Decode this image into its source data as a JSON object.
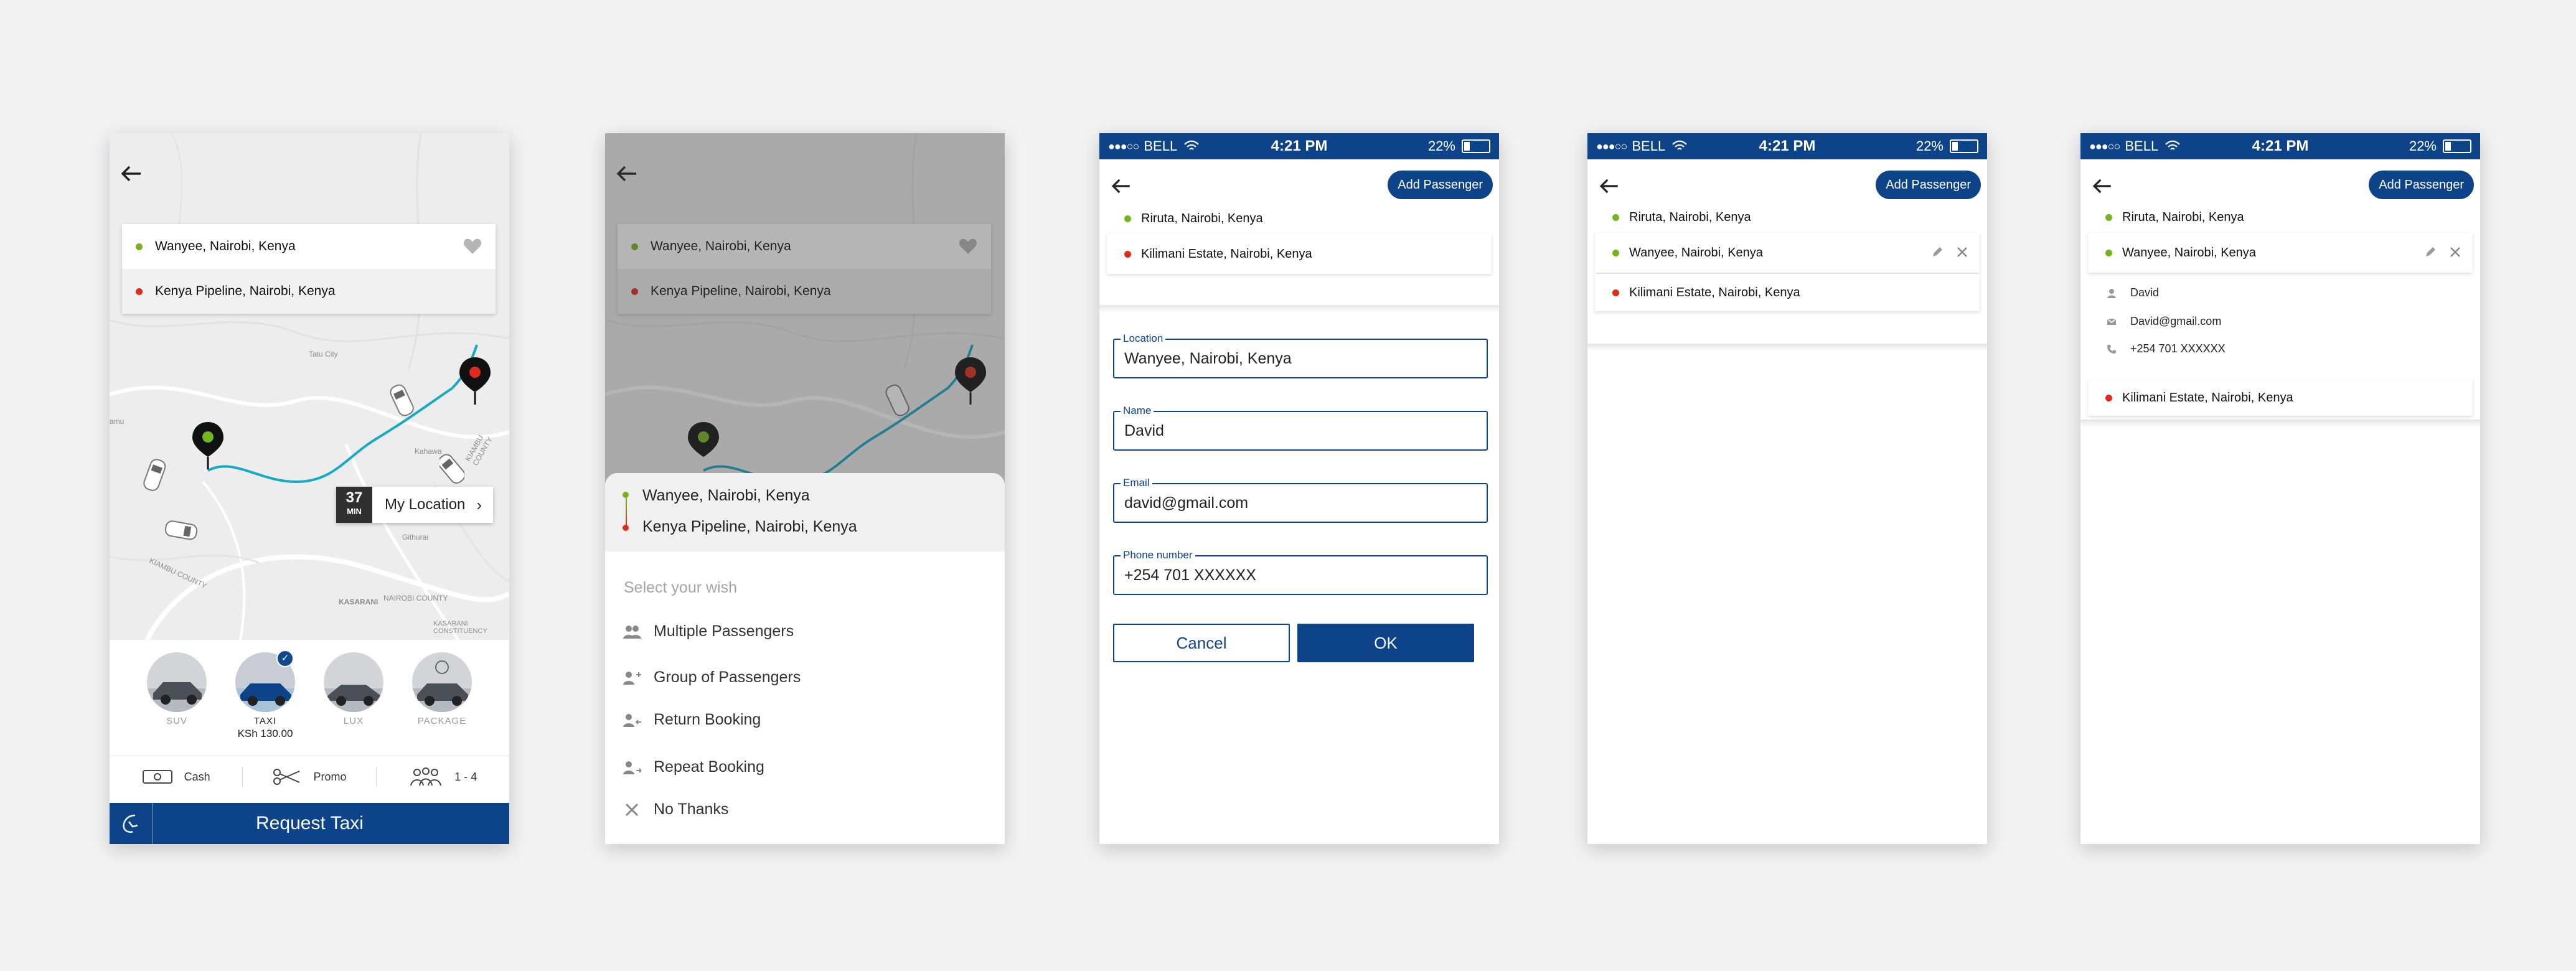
{
  "screen1": {
    "pickup": "Wanyee, Nairobi, Kenya",
    "dropoff": "Kenya Pipeline, Nairobi, Kenya",
    "map_labels": [
      "Tatu City",
      "Kahawa",
      "KIAMBU COUNTY",
      "KIAMBU COUNTY",
      "NAIROBI COUNTY",
      "Githurai",
      "KASARANI",
      "KASARANI CONSTITUENCY",
      "amu"
    ],
    "eta": {
      "value": "37",
      "unit": "MIN",
      "label": "My Location"
    },
    "cars": [
      {
        "name": "SUV",
        "price": "",
        "selected": false
      },
      {
        "name": "TAXI",
        "price": "KSh 130.00",
        "selected": true
      },
      {
        "name": "LUX",
        "price": "",
        "selected": false
      },
      {
        "name": "PACKAGE",
        "price": "",
        "selected": false
      }
    ],
    "options": {
      "cash": "Cash",
      "promo": "Promo",
      "seats": "1 - 4"
    },
    "request_label": "Request Taxi"
  },
  "screen2": {
    "pickup": "Wanyee, Nairobi, Kenya",
    "dropoff": "Kenya Pipeline, Nairobi, Kenya",
    "sheet_pickup": "Wanyee, Nairobi, Kenya",
    "sheet_dropoff": "Kenya Pipeline, Nairobi, Kenya",
    "sheet_title": "Select your wish",
    "options": [
      "Multiple Passengers",
      "Group of Passengers",
      "Return Booking",
      "Repeat Booking",
      "No Thanks"
    ]
  },
  "status_bar": {
    "carrier": "BELL",
    "time": "4:21 PM",
    "battery": "22%"
  },
  "add_passenger_label": "Add Passenger",
  "screen3": {
    "stops": [
      "Riruta, Nairobi, Kenya",
      "Kilimani Estate, Nairobi, Kenya"
    ],
    "fields": [
      {
        "label": "Location",
        "value": "Wanyee, Nairobi, Kenya"
      },
      {
        "label": "Name",
        "value": "David"
      },
      {
        "label": "Email",
        "value": "david@gmail.com"
      },
      {
        "label": "Phone number",
        "value": "+254 701 XXXXXX"
      }
    ],
    "cancel_label": "Cancel",
    "ok_label": "OK"
  },
  "screen4": {
    "stops": [
      "Riruta, Nairobi, Kenya",
      "Wanyee, Nairobi, Kenya",
      "Kilimani Estate, Nairobi, Kenya"
    ]
  },
  "screen5": {
    "stops": [
      "Riruta, Nairobi, Kenya",
      "Wanyee, Nairobi, Kenya",
      "Kilimani Estate, Nairobi, Kenya"
    ],
    "passenger": {
      "name": "David",
      "email": "David@gmail.com",
      "phone": "+254 701 XXXXXX"
    }
  },
  "colors": {
    "brand": "#0d4389",
    "pickup_dot": "#73b421",
    "dropoff_dot": "#e02a1c",
    "route": "#18a9c4"
  }
}
